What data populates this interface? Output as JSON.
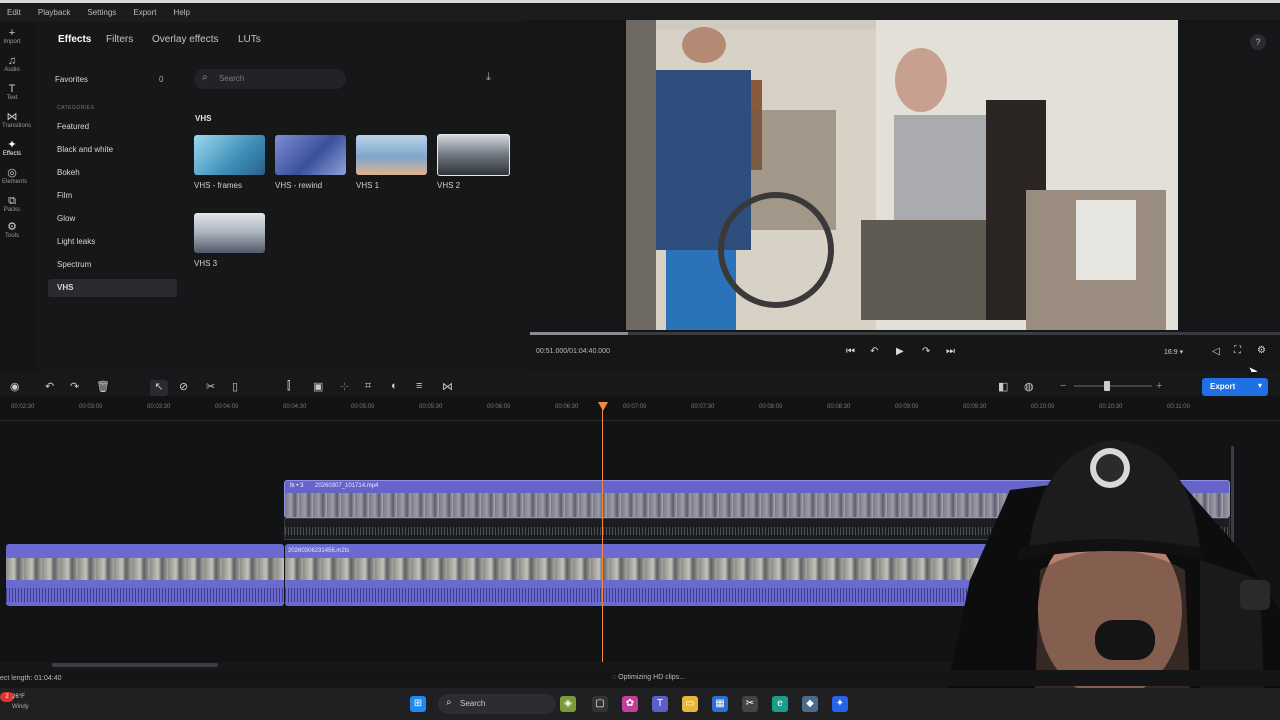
{
  "menu": [
    "Edit",
    "Playback",
    "Settings",
    "Export",
    "Help"
  ],
  "rail": [
    {
      "label": "Import",
      "icon": "plus-icon"
    },
    {
      "label": "Audio",
      "icon": "music-icon"
    },
    {
      "label": "Text",
      "icon": "text-icon"
    },
    {
      "label": "Transitions",
      "icon": "transition-icon"
    },
    {
      "label": "Effects",
      "icon": "effects-icon"
    },
    {
      "label": "Elements",
      "icon": "elements-icon"
    },
    {
      "label": "Packs",
      "icon": "packs-icon"
    },
    {
      "label": "Tools",
      "icon": "tools-icon"
    }
  ],
  "tabs": [
    "Effects",
    "Filters",
    "Overlay effects",
    "LUTs"
  ],
  "favorites": {
    "label": "Favorites",
    "count": "0"
  },
  "categories_label": "CATEGORIES",
  "categories": [
    "Featured",
    "Black and white",
    "Bokeh",
    "Film",
    "Glow",
    "Light leaks",
    "Spectrum",
    "VHS"
  ],
  "search": {
    "placeholder": "Search"
  },
  "section_title": "VHS",
  "effects": [
    {
      "label": "VHS - frames",
      "color": "#5fa9c9"
    },
    {
      "label": "VHS - rewind",
      "color": "#4a6fb0"
    },
    {
      "label": "VHS 1",
      "color": "#8ab1d0"
    },
    {
      "label": "VHS 2",
      "color": "#6f7a86"
    },
    {
      "label": "VHS 3",
      "color": "#9fa6b2"
    }
  ],
  "player": {
    "timecode": "00:51.000/01:04:40.000",
    "progress": 0.13,
    "ratio": "16:9"
  },
  "timeline": {
    "ruler": [
      "00:02:30",
      "00:03:00",
      "00:03:30",
      "00:04:00",
      "00:04:30",
      "00:05:00",
      "00:05:30",
      "00:06:00",
      "00:06:30",
      "00:07:00",
      "00:07:30",
      "00:08:00",
      "00:08:30",
      "00:09:00",
      "00:09:30",
      "00:10:00",
      "00:10:30",
      "00:11:00"
    ],
    "clip1": "20260307_101714.mp4",
    "clip1_tag": "fx • 3",
    "clip2": "20260306231456.m2ts",
    "export_label": "Export"
  },
  "status": {
    "project_length": "ect length: 01:04:40",
    "optimizing": "Optimizing HD clips..."
  },
  "taskbar": {
    "weather_temp": "26°F",
    "weather_desc": "Windy",
    "search": "Search"
  },
  "colors": {
    "accent": "#1f6fe5",
    "clip": "#6f6fd8",
    "playhead": "#f08a3c"
  }
}
